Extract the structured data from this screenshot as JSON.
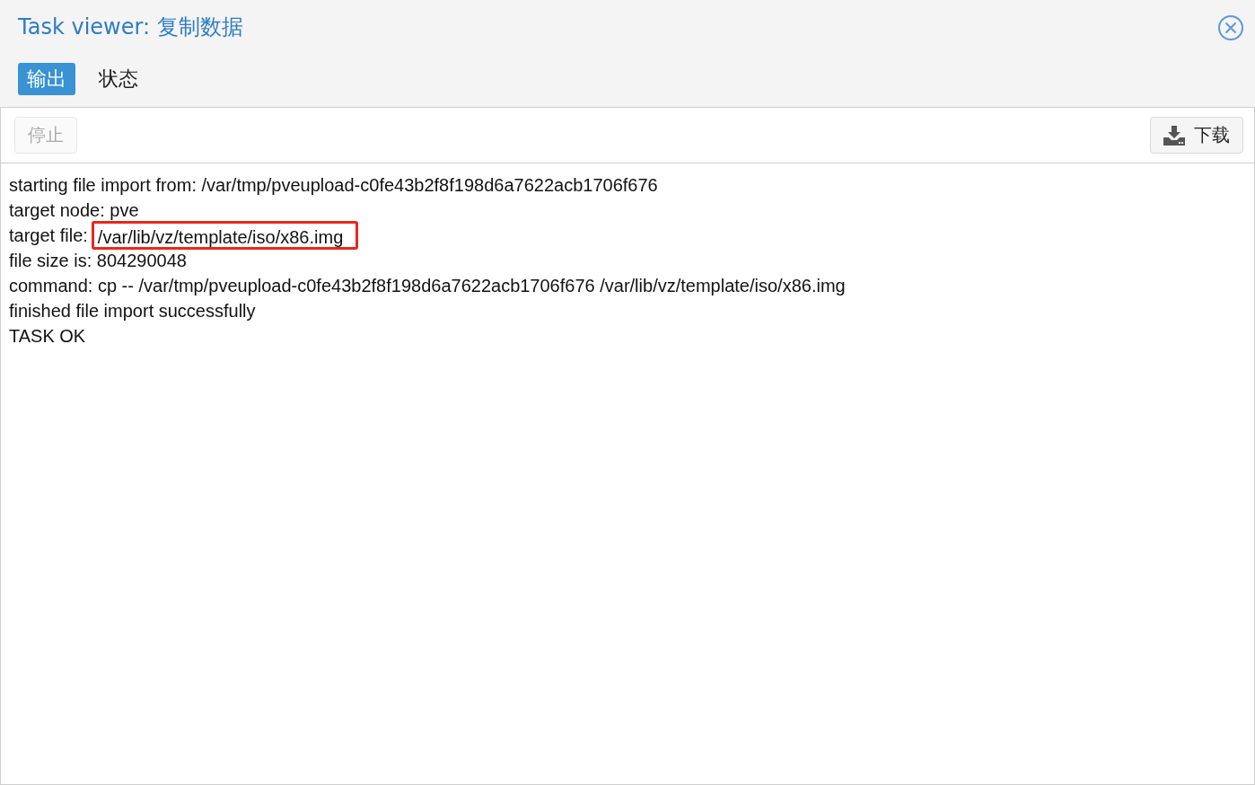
{
  "window": {
    "title": "Task viewer: 复制数据"
  },
  "tabs": [
    {
      "label": "输出",
      "selected": true
    },
    {
      "label": "状态",
      "selected": false
    }
  ],
  "toolbar": {
    "buttons": [
      {
        "label": "停止",
        "disabled": true,
        "kind": "plain"
      },
      {
        "label": "下载",
        "disabled": false,
        "kind": "download"
      }
    ]
  },
  "log": [
    {
      "text": "starting file import from: /var/tmp/pveupload-c0fe43b2f8f198d6a7622acb1706f676"
    },
    {
      "text": "target node: pve"
    },
    {
      "text": "target file:",
      "highlight": "/var/lib/vz/template/iso/x86.img"
    },
    {
      "text": "file size is: 804290048"
    },
    {
      "text": "command: cp -- /var/tmp/pveupload-c0fe43b2f8f198d6a7622acb1706f676 /var/lib/vz/template/iso/x86.img"
    },
    {
      "text": "finished file import successfully"
    },
    {
      "text": "TASK OK"
    }
  ]
}
